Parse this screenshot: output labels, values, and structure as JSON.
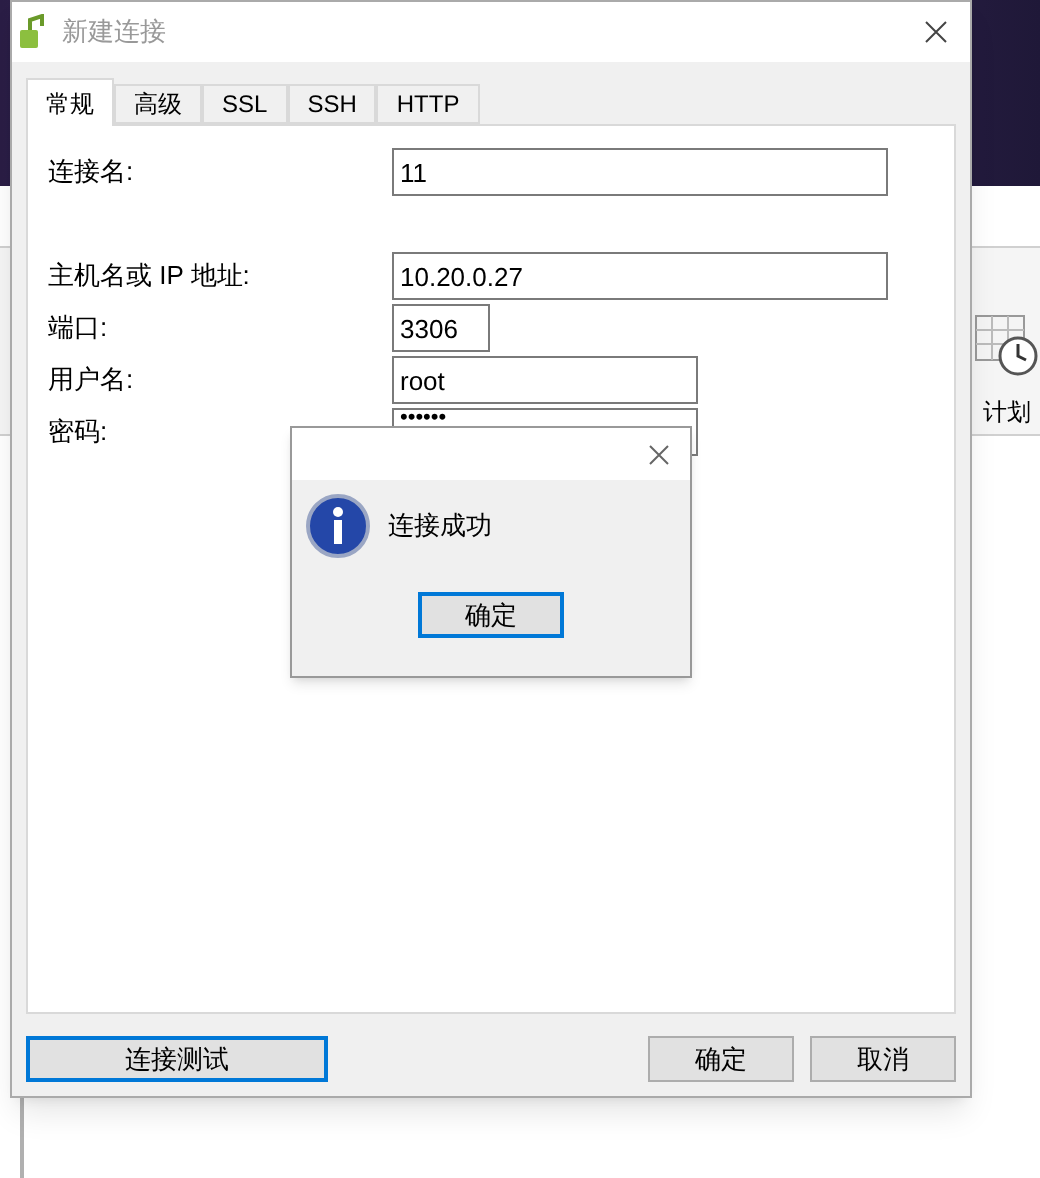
{
  "background_app": {
    "toolbar_label": "计划"
  },
  "dialog": {
    "title": "新建连接",
    "tabs": [
      {
        "label": "常规",
        "selected": true
      },
      {
        "label": "高级",
        "selected": false
      },
      {
        "label": "SSL",
        "selected": false
      },
      {
        "label": "SSH",
        "selected": false
      },
      {
        "label": "HTTP",
        "selected": false
      }
    ],
    "field_groups": [
      [
        {
          "label": "连接名:",
          "value": "11",
          "kind": "text"
        }
      ],
      [
        {
          "label": "主机名或 IP 地址:",
          "value": "10.20.0.27",
          "kind": "text"
        },
        {
          "label": "端口:",
          "value": "3306",
          "kind": "number"
        },
        {
          "label": "用户名:",
          "value": "root",
          "kind": "short"
        },
        {
          "label": "密码:",
          "value": "••••••",
          "kind": "password"
        }
      ]
    ],
    "buttons": [
      {
        "label": "连接测试",
        "focused": true
      },
      {
        "label": "确定",
        "focused": false
      },
      {
        "label": "取消",
        "focused": false
      }
    ]
  },
  "message_box": {
    "message": "连接成功",
    "button": {
      "label": "确定",
      "focused": true
    }
  }
}
